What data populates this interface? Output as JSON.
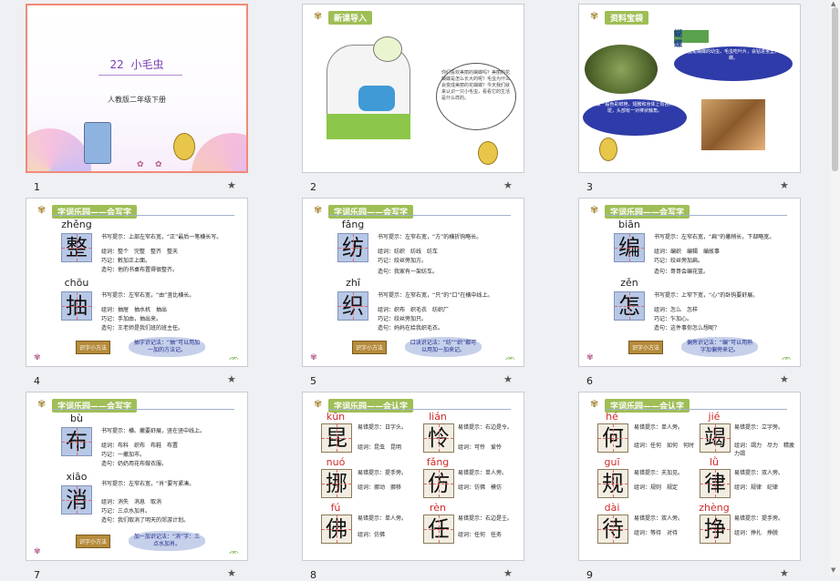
{
  "slides": [
    {
      "number": "1",
      "title": "22  小毛虫",
      "subtitle": "人教版二年级下册"
    },
    {
      "number": "2",
      "header": "新课导入",
      "text": "你们喜欢美丽的蝴蝶吗？美丽的花蝴蝶是怎么长大的呢？毛虫为什么会变成美丽的花蝴蝶？今天我们就来认识一只小毛虫，看看它的生活是什么样的。"
    },
    {
      "number": "3",
      "header": "资料宝袋",
      "word": "蝴蝶",
      "text_right": "小毛虫是蝴蝶的幼虫，毛虫吃叶片，会钻进茧里，变成蝶。",
      "text_left": "蝴蝶一般色彩鲜艳，翅膀和身体上有各种花斑，头部有一对棒状触角。"
    },
    {
      "number": "4",
      "header": "字词乐园——会写字",
      "chars": [
        {
          "py": "zhěng",
          "ch": "整",
          "l1": "书写提示：上部左窄右宽，“正”最后一笔横长写。",
          "l2": "组词：整个　完整　整齐　整天",
          "l3": "巧记：敕加正上面。",
          "l4": "造句：他的书桌布置得很整齐。"
        },
        {
          "py": "chōu",
          "ch": "抽",
          "l1": "书写提示：左窄右宽，“由”竖比横长。",
          "l2": "组词：抽屉　抽水机　抽出",
          "l3": "巧记：手加由，抽出来。",
          "l4": "造句：王老师是我们班的班主任。"
        }
      ],
      "tip": "识字小方法",
      "bubble": "抽字识记法：“抽”可以用加一加的方法记。"
    },
    {
      "number": "5",
      "header": "字词乐园——会写字",
      "chars": [
        {
          "py": "fǎng",
          "ch": "纺",
          "l1": "书写提示：左窄右宽，“方”的横折钩略长。",
          "l2": "组词：纺织　纺线　纺车",
          "l3": "巧记：绞丝旁加方。",
          "l4": "造句：我家有一架纺车。"
        },
        {
          "py": "zhī",
          "ch": "织",
          "l1": "书写提示：左窄右宽，“只”的“口”在横中线上。",
          "l2": "组词：织布　织毛衣　纺织厂",
          "l3": "巧记：绞丝旁加只。",
          "l4": "造句：妈妈在给我织毛衣。"
        }
      ],
      "tip": "识字小方法",
      "bubble": "口诀识记法：“纺”“织”都可以用加一加来记。"
    },
    {
      "number": "6",
      "header": "字词乐园——会写字",
      "chars": [
        {
          "py": "biān",
          "ch": "编",
          "l1": "书写提示：左窄右宽，“扁”的撇稍长，下部略宽。",
          "l2": "组词：编织　编辑　编故事",
          "l3": "巧记：绞丝旁加扁。",
          "l4": "造句：哥哥会编花篮。"
        },
        {
          "py": "zěn",
          "ch": "怎",
          "l1": "书写提示：上窄下宽，“心”的卧钩要舒展。",
          "l2": "组词：怎么　怎样",
          "l3": "巧记：乍加心。",
          "l4": "造句：这件事你怎么想呢？"
        }
      ],
      "tip": "识字小方法",
      "bubble": "偏旁识记法：“编”可以用熟字加偏旁来记。"
    },
    {
      "number": "7",
      "header": "字词乐园——会写字",
      "chars": [
        {
          "py": "bù",
          "ch": "布",
          "l1": "书写提示：横、撇要舒展，竖在竖中线上。",
          "l2": "组词：布料　织布　布鞋　布置",
          "l3": "巧记：一撇加市。",
          "l4": "造句：奶奶用花布做衣服。"
        },
        {
          "py": "xiāo",
          "ch": "消",
          "l1": "书写提示：左窄右宽，“肖”要写紧凑。",
          "l2": "组词：消失　消息　取消",
          "l3": "巧记：三点水加肖。",
          "l4": "造句：我们取消了明天的郊游计划。"
        }
      ],
      "tip": "识字小方法",
      "bubble": "加一加识记法：“消”字：三点水加肖。"
    },
    {
      "number": "8",
      "header": "字词乐园——会认字",
      "chars": [
        {
          "py": "kūn",
          "ch": "昆",
          "l1": "易错提示：日字头。",
          "l2": "组词：昆虫　昆明"
        },
        {
          "py": "lián",
          "ch": "怜",
          "l1": "易错提示：右边是令。",
          "l2": "组词：可怜　爱怜"
        },
        {
          "py": "nuó",
          "ch": "挪",
          "l1": "易错提示：提手旁。",
          "l2": "组词：挪动　挪移"
        },
        {
          "py": "fǎng",
          "ch": "仿",
          "l1": "易错提示：单人旁。",
          "l2": "组词：仿佛　模仿"
        },
        {
          "py": "fú",
          "ch": "佛",
          "l1": "易错提示：单人旁。",
          "l2": "组词：仿佛"
        },
        {
          "py": "rèn",
          "ch": "任",
          "l1": "易错提示：右边是壬。",
          "l2": "组词：任何　任务"
        }
      ]
    },
    {
      "number": "9",
      "header": "字词乐园——会认字",
      "chars": [
        {
          "py": "hé",
          "ch": "何",
          "l1": "易错提示：单人旁。",
          "l2": "组词：任何　如何　何时"
        },
        {
          "py": "jié",
          "ch": "竭",
          "l1": "易错提示：立字旁。",
          "l2": "组词：竭力　尽力　精疲力竭"
        },
        {
          "py": "guī",
          "ch": "规",
          "l1": "易错提示：夫加见。",
          "l2": "组词：规则　规定"
        },
        {
          "py": "lǜ",
          "ch": "律",
          "l1": "易错提示：双人旁。",
          "l2": "组词：规律　纪律"
        },
        {
          "py": "dài",
          "ch": "待",
          "l1": "易错提示：双人旁。",
          "l2": "组词：等待　对待"
        },
        {
          "py": "zhèng",
          "ch": "挣",
          "l1": "易错提示：提手旁。",
          "l2": "组词：挣扎　挣脱"
        }
      ]
    }
  ],
  "colors": {
    "accent": "#9fbe55",
    "selected": "#f08a78",
    "char_bg": "#b7c8e6",
    "bubble_text": "#1e2a8c",
    "highlight": "#e0261c"
  }
}
